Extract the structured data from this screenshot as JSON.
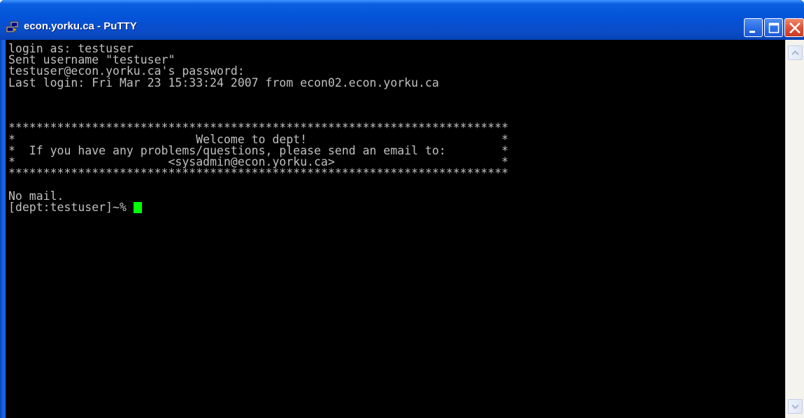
{
  "window": {
    "title": "econ.yorku.ca - PuTTY",
    "icon": "putty-icon",
    "controls": [
      "minimize-icon",
      "maximize-icon",
      "close-icon"
    ]
  },
  "terminal": {
    "lines": [
      "login as: testuser",
      "Sent username \"testuser\"",
      "testuser@econ.yorku.ca's password:",
      "Last login: Fri Mar 23 15:33:24 2007 from econ02.econ.yorku.ca",
      "",
      "",
      "",
      "************************************************************************",
      "*                          Welcome to dept!                            *",
      "*  If you have any problems/questions, please send an email to:        *",
      "*                      <sysadmin@econ.yorku.ca>                        *",
      "************************************************************************",
      "",
      "No mail."
    ],
    "prompt": "[dept:testuser]~% ",
    "colors": {
      "background": "#000000",
      "foreground": "#c0c0c0",
      "cursor": "#00ff00"
    }
  },
  "theme": {
    "titlebar": "#0453d8",
    "close_button": "#e2523a"
  }
}
